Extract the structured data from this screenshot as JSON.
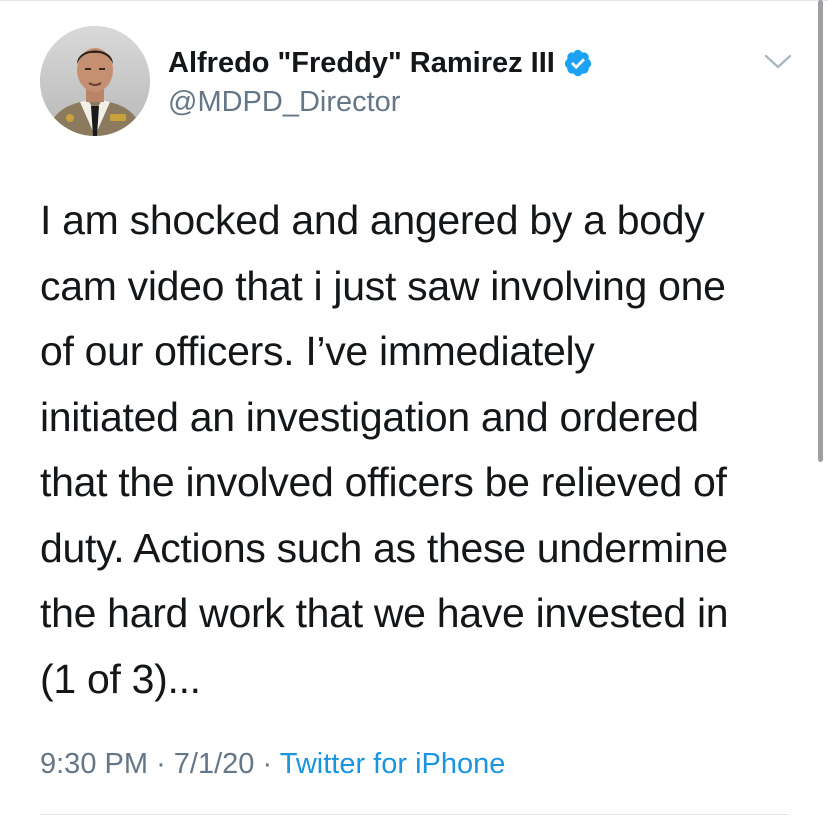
{
  "tweet": {
    "author": {
      "display_name": "Alfredo \"Freddy\" Ramirez III",
      "handle": "@MDPD_Director",
      "verified": true,
      "avatar_icon": "profile-photo"
    },
    "text": "I am shocked and angered by a body\ncam video that i just saw involving one\nof our officers. I’ve immediately\ninitiated an investigation and ordered\nthat the involved officers be relieved of\nduty. Actions such as these undermine\nthe hard work that we have invested in\n(1 of 3)...",
    "time": "9:30 PM",
    "separator": "·",
    "date": "7/1/20",
    "source": "Twitter for iPhone"
  },
  "colors": {
    "accent": "#1b95e0",
    "verified": "#1da1f2",
    "secondary_text": "#657786",
    "divider": "#e1e8ed"
  },
  "icons": {
    "verified": "verified-badge-icon",
    "caret": "chevron-down-icon"
  }
}
